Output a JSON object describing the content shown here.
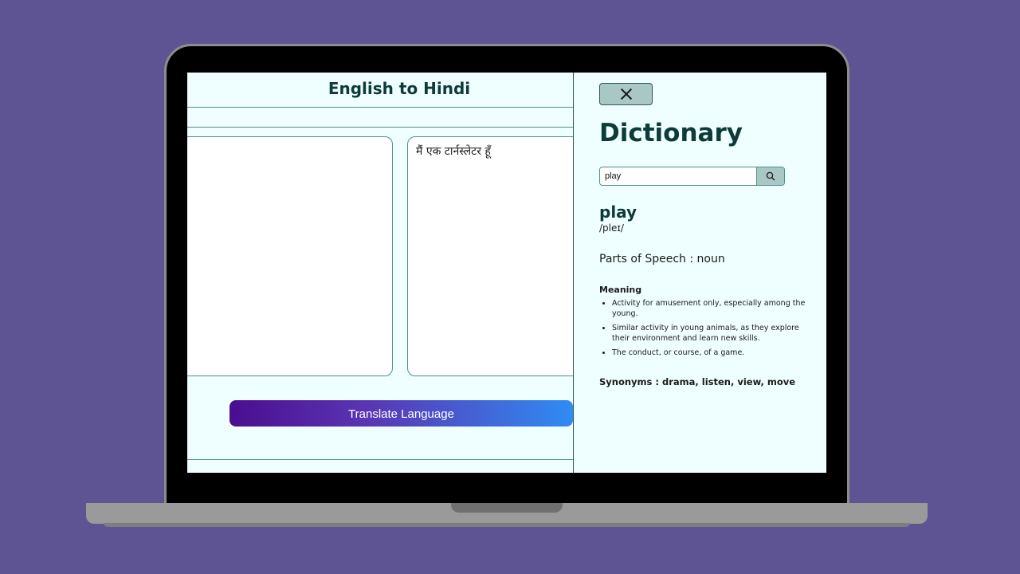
{
  "translator": {
    "title": "English to Hindi",
    "input_text": "",
    "output_text": "मैं एक टार्नस्लेटर हूँ",
    "translate_button_label": "Translate Language"
  },
  "dictionary": {
    "title": "Dictionary",
    "search": {
      "value": "play",
      "icon": "search-icon"
    },
    "close_icon": "close-icon",
    "word": "play",
    "phonetic": "/pleɪ/",
    "parts_of_speech": "Parts of Speech : noun",
    "meaning_heading": "Meaning",
    "meanings": [
      "Activity for amusement only, especially among the young.",
      "Similar activity in young animals, as they explore their environment and learn new skills.",
      "The conduct, or course, of a game."
    ],
    "synonyms": "Synonyms : drama, listen, view, move"
  },
  "colors": {
    "background": "#5f5493",
    "screen": "#effefe",
    "accent_dark": "#0c3b3a",
    "button_gradient_start": "#4a0e8f",
    "button_gradient_end": "#2f8cf3"
  }
}
